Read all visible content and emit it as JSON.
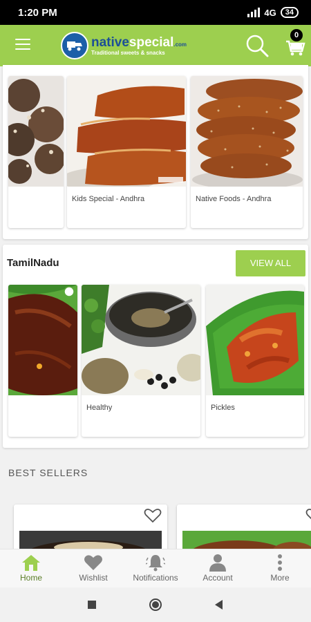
{
  "status_bar": {
    "time": "1:20 PM",
    "network": "4G",
    "battery": "34"
  },
  "app_bar": {
    "logo_native": "native",
    "logo_special": "special",
    "logo_domain": ".com",
    "logo_tagline": "Traditional sweets & snacks",
    "cart_count": "0"
  },
  "section_andhra": {
    "cards": [
      {
        "label": ""
      },
      {
        "label": "Kids Special - Andhra"
      },
      {
        "label": "Native Foods - Andhra"
      }
    ]
  },
  "section_tamilnadu": {
    "title": "TamilNadu",
    "view_all": "VIEW ALL",
    "cards": [
      {
        "label": ""
      },
      {
        "label": "Healthy"
      },
      {
        "label": "Pickles"
      }
    ]
  },
  "best_sellers": {
    "title": "BEST SELLERS"
  },
  "bottom_nav": {
    "items": [
      {
        "label": "Home",
        "icon": "home-icon",
        "active": true
      },
      {
        "label": "Wishlist",
        "icon": "heart-icon"
      },
      {
        "label": "Notifications",
        "icon": "bell-icon"
      },
      {
        "label": "Account",
        "icon": "person-icon"
      },
      {
        "label": "More",
        "icon": "more-vertical-icon"
      }
    ]
  },
  "colors": {
    "brand_green": "#9dcf4f",
    "brand_blue": "#1c5fa8"
  }
}
